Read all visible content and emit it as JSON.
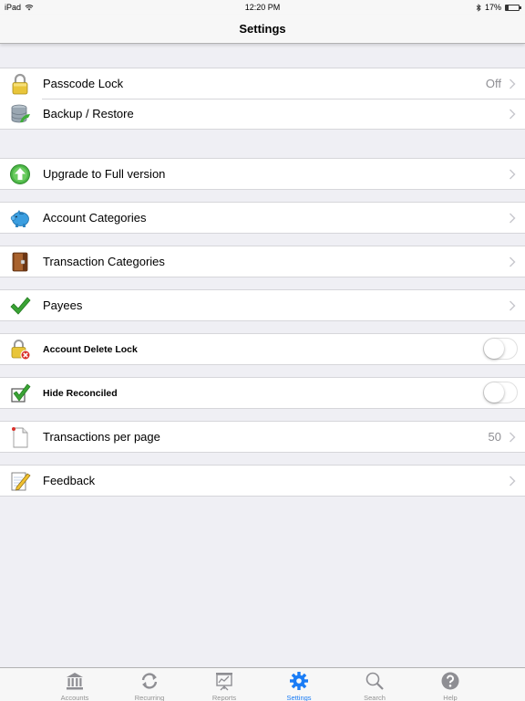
{
  "status_bar": {
    "device": "iPad",
    "time": "12:20 PM",
    "battery": "17%"
  },
  "nav": {
    "title": "Settings"
  },
  "groups": [
    {
      "rows": [
        {
          "label": "Passcode Lock",
          "value": "Off",
          "icon": "padlock-icon"
        },
        {
          "label": "Backup / Restore",
          "value": "",
          "icon": "database-icon"
        }
      ]
    },
    {
      "rows": [
        {
          "label": "Upgrade to Full version",
          "icon": "upgrade-arrow-icon"
        }
      ]
    },
    {
      "rows": [
        {
          "label": "Account Categories",
          "icon": "piggy-bank-icon"
        }
      ]
    },
    {
      "rows": [
        {
          "label": "Transaction Categories",
          "icon": "ledger-book-icon"
        }
      ]
    },
    {
      "rows": [
        {
          "label": "Payees",
          "icon": "checkmark-icon"
        }
      ]
    },
    {
      "rows": [
        {
          "label": "Account Delete Lock",
          "toggle": false,
          "icon": "padlock-delete-icon"
        }
      ]
    },
    {
      "rows": [
        {
          "label": "Hide Reconciled",
          "toggle": false,
          "icon": "checkbox-checked-icon"
        }
      ]
    },
    {
      "rows": [
        {
          "label": "Transactions per page",
          "value": "50",
          "icon": "document-icon"
        }
      ]
    },
    {
      "rows": [
        {
          "label": "Feedback",
          "icon": "notepad-pencil-icon"
        }
      ]
    }
  ],
  "tabs": [
    {
      "label": "Accounts",
      "icon": "bank-icon",
      "active": false
    },
    {
      "label": "Recurring",
      "icon": "refresh-icon",
      "active": false
    },
    {
      "label": "Reports",
      "icon": "presentation-icon",
      "active": false
    },
    {
      "label": "Settings",
      "icon": "gear-icon",
      "active": true
    },
    {
      "label": "Search",
      "icon": "magnifier-icon",
      "active": false
    },
    {
      "label": "Help",
      "icon": "help-icon",
      "active": false
    }
  ],
  "colors": {
    "accent": "#1a7cf5",
    "inactive": "#929292",
    "background": "#efeff4"
  }
}
